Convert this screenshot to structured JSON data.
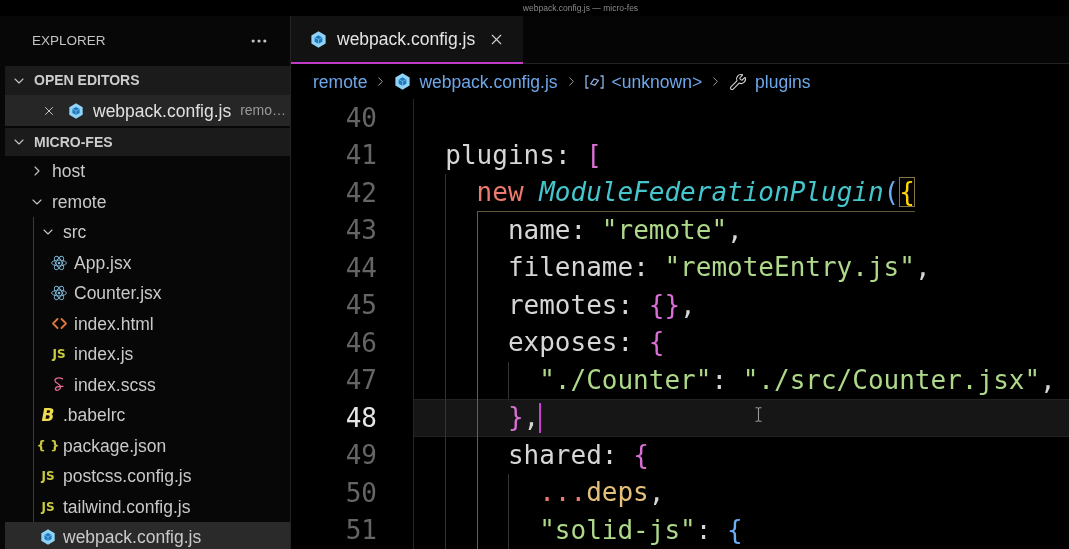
{
  "window": {
    "title": "webpack.config.js — micro-fes"
  },
  "sidebar": {
    "title": "EXPLORER",
    "open_editors": {
      "title": "OPEN EDITORS",
      "expanded": true,
      "items": [
        {
          "name": "webpack.config.js",
          "description": "remo…",
          "kind": "webpack",
          "selected": true
        }
      ]
    },
    "workspace": {
      "title": "MICRO-FES",
      "expanded": true,
      "children": [
        {
          "name": "host",
          "kind": "folder",
          "expanded": false,
          "selected": false
        },
        {
          "name": "remote",
          "kind": "folder",
          "expanded": true,
          "selected": false,
          "children": [
            {
              "name": "src",
              "kind": "folder",
              "expanded": true,
              "selected": false,
              "children": [
                {
                  "name": "App.jsx",
                  "kind": "react",
                  "selected": false
                },
                {
                  "name": "Counter.jsx",
                  "kind": "react",
                  "selected": false
                },
                {
                  "name": "index.html",
                  "kind": "html",
                  "selected": false
                },
                {
                  "name": "index.js",
                  "kind": "js",
                  "icon_text": "JS",
                  "selected": false
                },
                {
                  "name": "index.scss",
                  "kind": "sass",
                  "selected": false
                }
              ]
            },
            {
              "name": ".babelrc",
              "kind": "babel",
              "icon_text": "B",
              "selected": false
            },
            {
              "name": "package.json",
              "kind": "json",
              "icon_text": "{ }",
              "selected": false
            },
            {
              "name": "postcss.config.js",
              "kind": "js",
              "icon_text": "JS",
              "selected": false
            },
            {
              "name": "tailwind.config.js",
              "kind": "js",
              "icon_text": "JS",
              "selected": false
            },
            {
              "name": "webpack.config.js",
              "kind": "webpack",
              "selected": true
            }
          ]
        }
      ]
    }
  },
  "editor": {
    "tabs": [
      {
        "label": "webpack.config.js",
        "kind": "webpack",
        "selected": true
      }
    ],
    "breadcrumbs": [
      {
        "label": "remote",
        "kind": "folder"
      },
      {
        "label": "webpack.config.js",
        "kind": "webpack"
      },
      {
        "label": "<unknown>",
        "kind": "variable"
      },
      {
        "label": "plugins",
        "kind": "property"
      }
    ],
    "lines": [
      {
        "number": "40",
        "current": false
      },
      {
        "number": "41",
        "current": false,
        "tokens": [
          {
            "text": "plugins",
            "kind": "key"
          },
          {
            "text": ": ",
            "kind": "punct"
          },
          {
            "text": "[",
            "kind": "bracket2"
          }
        ],
        "children": [
          {
            "number": "42",
            "current": false,
            "tokens": [
              {
                "text": "new ",
                "kind": "keyword"
              },
              {
                "text": "ModuleFederationPlugin",
                "kind": "class"
              },
              {
                "text": "(",
                "kind": "bracket3"
              },
              {
                "text": "{",
                "kind": "bracket-match"
              }
            ],
            "children": [
              {
                "number": "43",
                "current": false,
                "tokens": [
                  {
                    "text": "name",
                    "kind": "key"
                  },
                  {
                    "text": ": ",
                    "kind": "punct"
                  },
                  {
                    "text": "\"remote\"",
                    "kind": "string"
                  },
                  {
                    "text": ",",
                    "kind": "punct"
                  }
                ]
              },
              {
                "number": "44",
                "current": false,
                "tokens": [
                  {
                    "text": "filename",
                    "kind": "key"
                  },
                  {
                    "text": ": ",
                    "kind": "punct"
                  },
                  {
                    "text": "\"remoteEntry.js\"",
                    "kind": "string"
                  },
                  {
                    "text": ",",
                    "kind": "punct"
                  }
                ]
              },
              {
                "number": "45",
                "current": false,
                "tokens": [
                  {
                    "text": "remotes",
                    "kind": "key"
                  },
                  {
                    "text": ": ",
                    "kind": "punct"
                  },
                  {
                    "text": "{}",
                    "kind": "bracket2"
                  },
                  {
                    "text": ",",
                    "kind": "punct"
                  }
                ]
              },
              {
                "number": "46",
                "current": false,
                "tokens": [
                  {
                    "text": "exposes",
                    "kind": "key"
                  },
                  {
                    "text": ": ",
                    "kind": "punct"
                  },
                  {
                    "text": "{",
                    "kind": "bracket2"
                  }
                ],
                "children": [
                  {
                    "number": "47",
                    "current": false,
                    "tokens": [
                      {
                        "text": "\"./Counter\"",
                        "kind": "string"
                      },
                      {
                        "text": ": ",
                        "kind": "punct"
                      },
                      {
                        "text": "\"./src/Counter.jsx\"",
                        "kind": "string"
                      },
                      {
                        "text": ",",
                        "kind": "punct"
                      }
                    ]
                  }
                ]
              },
              {
                "number": "48",
                "current": true,
                "tokens": [
                  {
                    "text": "}",
                    "kind": "bracket2"
                  },
                  {
                    "text": ",",
                    "kind": "punct"
                  }
                ]
              },
              {
                "number": "49",
                "current": false,
                "tokens": [
                  {
                    "text": "shared",
                    "kind": "key"
                  },
                  {
                    "text": ": ",
                    "kind": "punct"
                  },
                  {
                    "text": "{",
                    "kind": "bracket2"
                  }
                ],
                "children": [
                  {
                    "number": "50",
                    "current": false,
                    "tokens": [
                      {
                        "text": "...",
                        "kind": "operator"
                      },
                      {
                        "text": "deps",
                        "kind": "variable"
                      },
                      {
                        "text": ",",
                        "kind": "punct"
                      }
                    ]
                  },
                  {
                    "number": "51",
                    "current": false,
                    "tokens": [
                      {
                        "text": "\"solid-js\"",
                        "kind": "string"
                      },
                      {
                        "text": ": ",
                        "kind": "punct"
                      },
                      {
                        "text": "{",
                        "kind": "bracket3"
                      }
                    ]
                  }
                ]
              }
            ]
          }
        ]
      }
    ]
  }
}
